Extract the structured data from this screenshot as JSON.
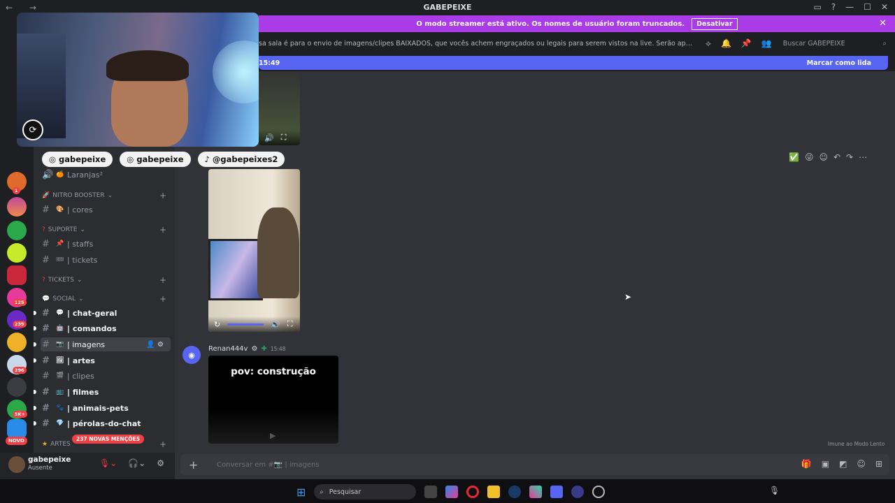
{
  "window": {
    "title": "GABEPEIXE",
    "nav": "← →",
    "controls": [
      "▭",
      "?",
      "—",
      "☐",
      "✕"
    ]
  },
  "streamer_banner": {
    "text": "O modo streamer está ativo. Os nomes de usuário foram truncados.",
    "button": "Desativar",
    "close": "✕"
  },
  "channel_topic": {
    "text": "sa sala é para o envio de imagens/clipes BAIXADOS, que vocês achem engraçados ou legais para serem vistos na live. Serão apagados prints de outras rede...",
    "search_placeholder": "Buscar GABEPEIXE"
  },
  "new_messages_bar": {
    "time": "15:49",
    "action": "Marcar como lida"
  },
  "guild_badges": [
    "1",
    "125",
    "239",
    "296",
    "5K+",
    "NOVO"
  ],
  "sidebar": {
    "partial_channel": "Laranjas²",
    "categories": [
      {
        "label": "NITRO BOOSTER"
      },
      {
        "label": "SUPORTE"
      },
      {
        "label": "TICKETS"
      },
      {
        "label": "SOCIAL"
      },
      {
        "label": "ARTES"
      }
    ],
    "channels": [
      {
        "name": "| cores",
        "emoji": "🎨"
      },
      {
        "name": "| staffs",
        "emoji": "📌"
      },
      {
        "name": "| tickets",
        "emoji": "🎟"
      },
      {
        "name": "| chat-geral",
        "emoji": "💬"
      },
      {
        "name": "| comandos",
        "emoji": "🤖"
      },
      {
        "name": "| imagens",
        "emoji": "📷"
      },
      {
        "name": "| artes",
        "emoji": "🖼"
      },
      {
        "name": "| clipes",
        "emoji": "🎬"
      },
      {
        "name": "| filmes",
        "emoji": "📺"
      },
      {
        "name": "| animais-pets",
        "emoji": "🐾"
      },
      {
        "name": "| pérolas-do-chat",
        "emoji": "💎"
      }
    ],
    "mentions_badge": "237 NOVAS MENÇÕES"
  },
  "user": {
    "name": "gabepeixe",
    "status": "Ausente"
  },
  "messages": {
    "author": "Renan444v",
    "time": "15:48",
    "video_caption": "pov: construção",
    "immune_note": "Imune ao Modo Lento"
  },
  "composer": {
    "placeholder": "Conversar em #📷 | imagens"
  },
  "overlay": {
    "pills": [
      {
        "icon": "◎",
        "text": "gabepeixe"
      },
      {
        "icon": "◎",
        "text": "gabepeixe"
      },
      {
        "icon": "♪",
        "text": "@gabepeixes2"
      }
    ]
  },
  "taskbar": {
    "search_placeholder": "Pesquisar"
  },
  "colors": {
    "accent": "#5865f2",
    "streamer": "#a93ce6",
    "danger": "#f23f43",
    "bg": "#313338"
  }
}
